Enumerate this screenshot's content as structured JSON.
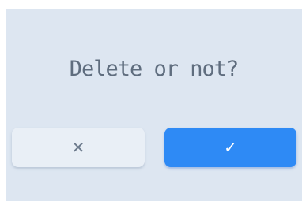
{
  "dialog": {
    "question": "Delete or not?",
    "cancel_button": {
      "icon": "close-icon",
      "glyph": "✕"
    },
    "confirm_button": {
      "icon": "check-icon",
      "glyph": "✓"
    }
  },
  "colors": {
    "background": "#dde6f1",
    "text": "#5f6d7e",
    "cancel_bg": "#e9eff6",
    "confirm_bg": "#2e8af5"
  }
}
